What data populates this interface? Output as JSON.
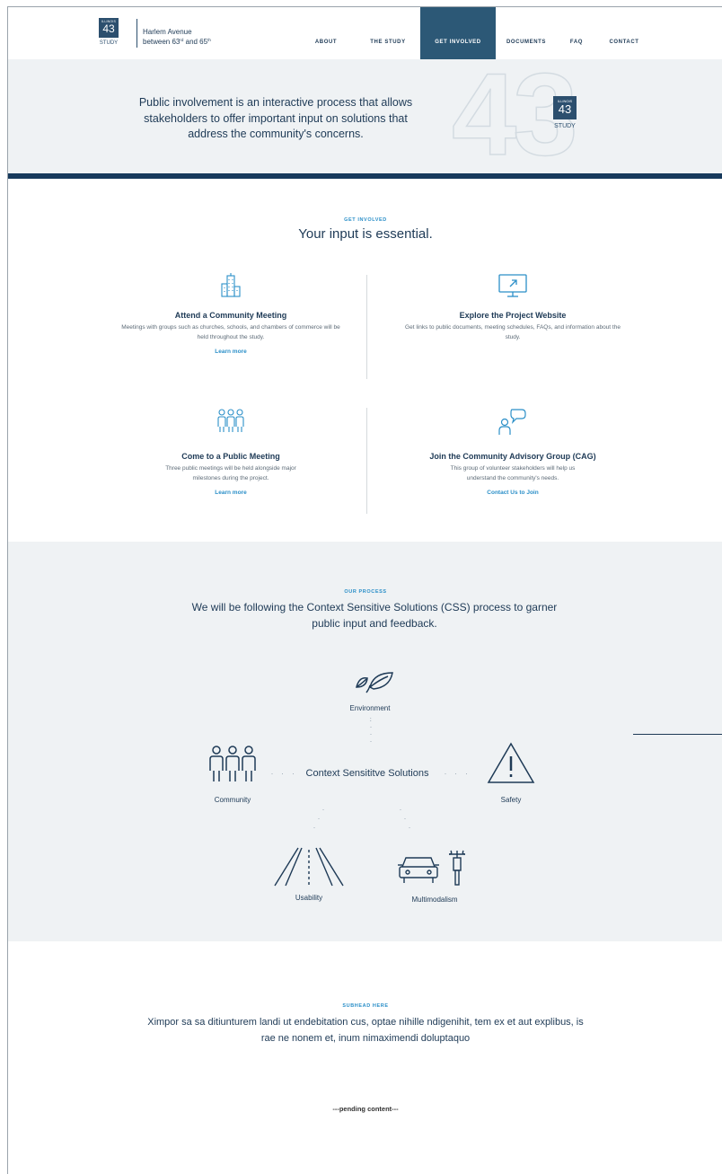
{
  "brand": {
    "logo_small": "ILLINOIS",
    "logo_number": "43",
    "logo_study": "STUDY",
    "title_line1": "Harlem Avenue",
    "title_line2_a": "between 63",
    "title_line2_sup1": "rd",
    "title_line2_b": " and 65",
    "title_line2_sup2": "th",
    "color": "#2c4f6e"
  },
  "nav": {
    "items": [
      {
        "label": "ABOUT"
      },
      {
        "label": "THE STUDY"
      },
      {
        "label": "GET INVOLVED",
        "active": true
      },
      {
        "label": "DOCUMENTS"
      },
      {
        "label": "FAQ"
      },
      {
        "label": "CONTACT"
      }
    ],
    "active_color": "#2c5876"
  },
  "hero": {
    "text": "Public involvement is an interactive process that allows stakeholders to offer important input on solutions that address the community's concerns.",
    "watermark": "43",
    "bar_color": "#173a5c"
  },
  "get_involved": {
    "kicker": "GET INVOLVED",
    "heading": "Your input is essential.",
    "accent": "#2b8fc8",
    "cards": [
      {
        "icon": "building-icon",
        "title": "Attend a Community Meeting",
        "desc": "Meetings with groups such as churches, schools, and chambers of commerce will be held throughout the study.",
        "link": "Learn more"
      },
      {
        "icon": "monitor-icon",
        "title": "Explore the Project Website",
        "desc": "Get links to public documents, meeting schedules, FAQs,  and information about the study.",
        "link": ""
      },
      {
        "icon": "people-icon",
        "title": "Come to a Public Meeting",
        "desc": "Three public meetings will be held alongside major milestones during the project.",
        "link": "Learn more"
      },
      {
        "icon": "speech-person-icon",
        "title": "Join the Community Advisory Group (CAG)",
        "desc": "This group of volunteer stakeholders will help us understand the community's needs.",
        "link": "Contact Us to Join"
      }
    ]
  },
  "process": {
    "kicker": "OUR PROCESS",
    "heading": "We will be following the Context Sensitive Solutions (CSS) process to garner public input and feedback.",
    "center": "Context Sensititve Solutions",
    "nodes": {
      "environment": "Environment",
      "community": "Community",
      "safety": "Safety",
      "usability": "Usability",
      "multimodalism": "Multimodalism"
    }
  },
  "subhead": {
    "kicker": "SUBHEAD HERE",
    "body": "Ximpor sa sa ditiunturem landi ut endebitation cus, optae nihille ndigenihit, tem ex et aut explibus, is rae ne nonem et, inum nimaximendi doluptaquo",
    "pending": "---pending content---"
  }
}
